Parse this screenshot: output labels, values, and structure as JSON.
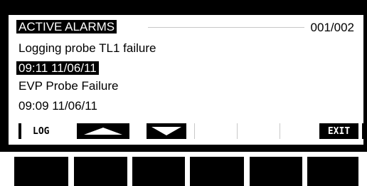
{
  "header": {
    "title": "ACTIVE ALARMS",
    "counter": "001/002"
  },
  "alarms": [
    {
      "message": "Logging probe TL1 failure",
      "timestamp": "09:11 11/06/11"
    },
    {
      "message": "EVP Probe Failure",
      "timestamp": "09:09 11/06/11"
    }
  ],
  "softkeys": {
    "log_label": "LOG",
    "up_icon": "up-arrow-icon",
    "down_icon": "down-arrow-icon",
    "exit_label": "EXIT"
  },
  "colors": {
    "bezel": "#000000",
    "screen": "#ffffff",
    "divider": "#c8c8c8"
  }
}
